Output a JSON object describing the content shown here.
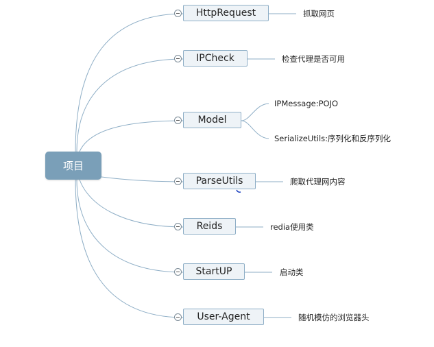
{
  "root": {
    "label": "项目"
  },
  "branches": [
    {
      "label": "HttpRequest",
      "children": [
        "抓取网页"
      ]
    },
    {
      "label": "IPCheck",
      "children": [
        "检查代理是否可用"
      ]
    },
    {
      "label": "Model",
      "children": [
        "IPMessage:POJO",
        "SerializeUtils:序列化和反序列化"
      ]
    },
    {
      "label": "ParseUtils",
      "children": [
        "爬取代理网内容"
      ]
    },
    {
      "label": "Reids",
      "children": [
        "redia使用类"
      ]
    },
    {
      "label": "StartUP",
      "children": [
        "启动类"
      ]
    },
    {
      "label": "User-Agent",
      "children": [
        "随机模仿的浏览器头"
      ]
    }
  ],
  "colors": {
    "line": "#8eaec6",
    "root_fill": "#7a9fb8",
    "node_fill": "#eef3f7"
  }
}
